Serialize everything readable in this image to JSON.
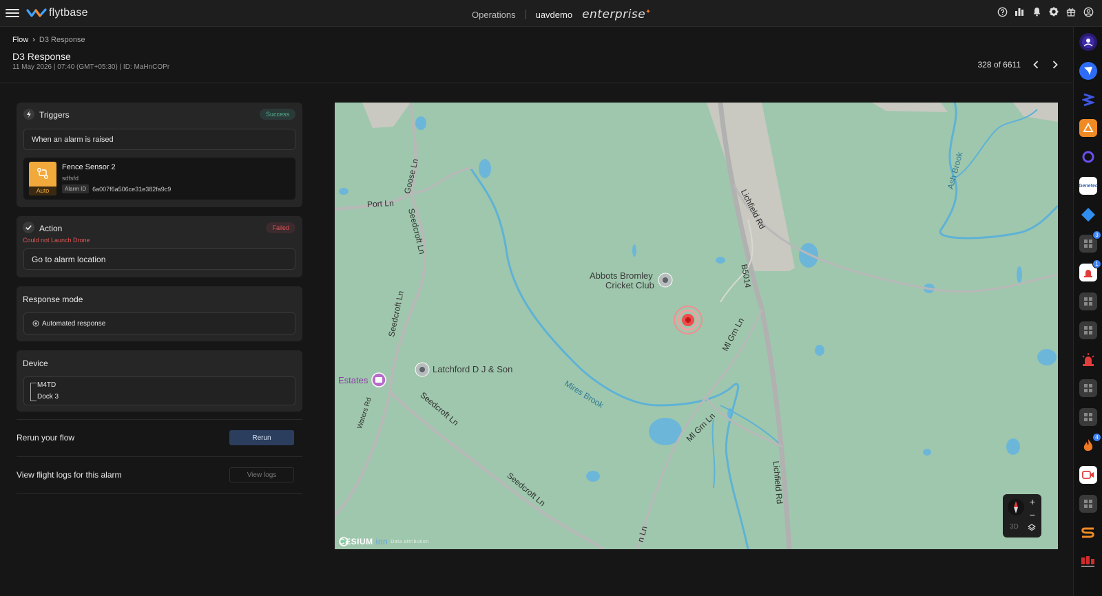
{
  "topbar": {
    "brand": "flytbase",
    "nav_operations": "Operations",
    "org": "uavdemo",
    "edition": "enterprise",
    "icons": [
      "help-icon",
      "analytics-icon",
      "bell-icon",
      "gear-icon",
      "gift-icon",
      "account-icon"
    ]
  },
  "breadcrumb": {
    "root": "Flow",
    "separator": "›",
    "current": "D3 Response"
  },
  "page": {
    "title": "D3 Response",
    "subtitle": "11 May 2026 | 07:40 (GMT+05:30) | ID: MaHnCOPr",
    "pager_text": "328 of 6611"
  },
  "triggers": {
    "title": "Triggers",
    "status": "Success",
    "condition": "When an alarm is raised",
    "sensor_name": "Fence Sensor 2",
    "sensor_desc": "sdfsfd",
    "sensor_mode": "Auto",
    "alarm_id_label": "Alarm ID",
    "alarm_id": "6a007f6a506ce31e382fa9c9"
  },
  "action": {
    "title": "Action",
    "status": "Failed",
    "error": "Could not Launch Drone",
    "value": "Go to alarm location"
  },
  "response_mode": {
    "title": "Response mode",
    "value": "Automated response"
  },
  "device": {
    "title": "Device",
    "drone": "M4TD",
    "dock": "Dock 3"
  },
  "rerun": {
    "label": "Rerun your flow",
    "button": "Rerun"
  },
  "logs": {
    "label": "View flight logs for this alarm",
    "button": "View logs"
  },
  "map": {
    "labels": {
      "port_ln": "Port Ln",
      "goose_ln": "Goose Ln",
      "seedcroft_1": "Seedcroft Ln",
      "seedcroft_2": "Seedcroft Ln",
      "seedcroft_3": "Seedcroft Ln",
      "seedcroft_4": "Seedcroft Ln",
      "lichfield_1": "Lichfield Rd",
      "lichfield_2": "Lichfield Rd",
      "b5014": "B5014",
      "mi_grn_1": "Ml Grn Ln",
      "mi_grn_2": "Ml Grn Ln",
      "ash_brook": "Ash Brook",
      "mires_brook": "Mires Brook",
      "waters_rd": "Waters Rd",
      "estates": "Estates",
      "cricket_1": "Abbots Bromley",
      "cricket_2": "Cricket Club",
      "latchford": "Latchford D J & Son",
      "n_ln": "n Ln"
    },
    "attribution": "CESIUM",
    "attribution_ion": "ion",
    "attribution_data": "Data attribution",
    "mode_3d": "3D"
  },
  "rail": {
    "badges": [
      "3",
      "1",
      "4"
    ]
  }
}
